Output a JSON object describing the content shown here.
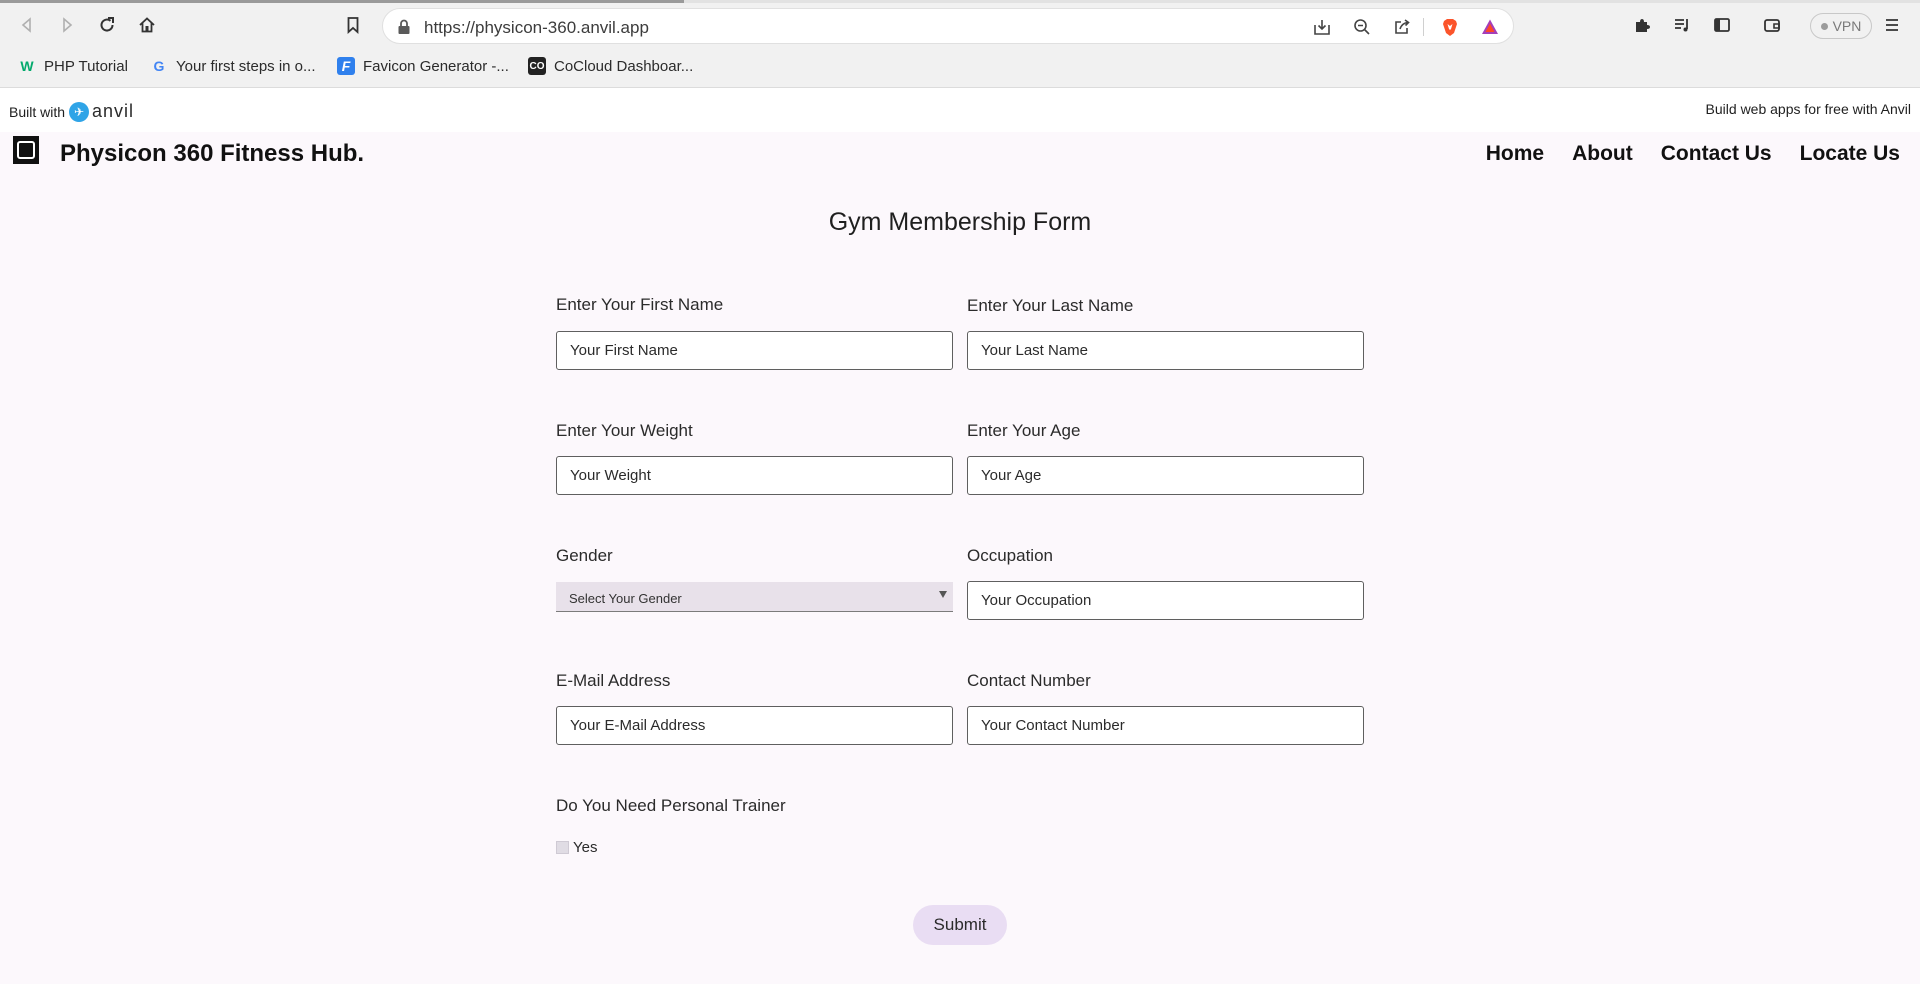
{
  "browser": {
    "url": "https://physicon-360.anvil.app",
    "vpn_label": "VPN",
    "bookmarks": [
      {
        "label": "PHP Tutorial",
        "icon": "w3schools-icon"
      },
      {
        "label": "Your first steps in o...",
        "icon": "google-icon"
      },
      {
        "label": "Favicon Generator -...",
        "icon": "favicon-generator-icon"
      },
      {
        "label": "CoCloud Dashboar...",
        "icon": "cocloud-icon"
      }
    ]
  },
  "banner": {
    "built_with": "Built with",
    "anvil_word": "anvil",
    "build_free": "Build web apps for free with Anvil"
  },
  "app": {
    "title": "Physicon 360 Fitness Hub.",
    "nav": [
      "Home",
      "About",
      "Contact Us",
      "Locate Us"
    ]
  },
  "form": {
    "title": "Gym Membership Form",
    "first_name": {
      "label": "Enter Your First Name",
      "placeholder": "Your First Name"
    },
    "last_name": {
      "label": "Enter Your Last Name",
      "placeholder": "Your Last Name"
    },
    "weight": {
      "label": "Enter Your Weight",
      "placeholder": "Your Weight"
    },
    "age": {
      "label": "Enter Your Age",
      "placeholder": "Your Age"
    },
    "gender": {
      "label": "Gender",
      "selected": "Select Your Gender"
    },
    "occupation": {
      "label": "Occupation",
      "placeholder": "Your Occupation"
    },
    "email": {
      "label": "E-Mail Address",
      "placeholder": "Your E-Mail Address"
    },
    "contact": {
      "label": "Contact Number",
      "placeholder": "Your Contact Number"
    },
    "trainer": {
      "label": "Do You Need Personal Trainer",
      "option": "Yes",
      "checked": false
    },
    "submit_label": "Submit"
  },
  "colors": {
    "page_bg": "#fcf8fc",
    "submit_bg": "#e9ddf3",
    "select_bg": "#e8e1ea",
    "anvil_blue": "#2fa4e7"
  }
}
